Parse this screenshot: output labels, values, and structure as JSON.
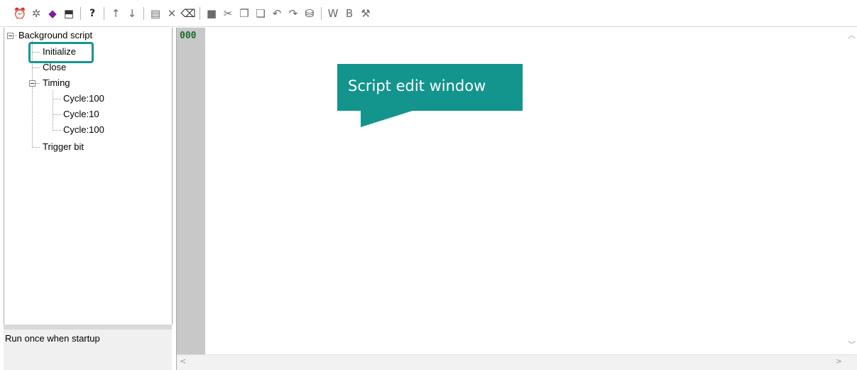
{
  "toolbar": {
    "buttons": [
      {
        "icon": "alarm-clock-icon",
        "glyph": "⏰"
      },
      {
        "icon": "tool-icon",
        "glyph": "✲"
      },
      {
        "icon": "gem-icon",
        "glyph": "◆"
      },
      {
        "icon": "disk-icon",
        "glyph": "⬒"
      },
      {
        "icon": "help-icon",
        "glyph": "?"
      },
      {
        "icon": "move-up-icon",
        "glyph": "↑"
      },
      {
        "icon": "move-down-icon",
        "glyph": "↓"
      },
      {
        "icon": "document-icon",
        "glyph": "▤"
      },
      {
        "icon": "delete-icon",
        "glyph": "✕"
      },
      {
        "icon": "eraser-icon",
        "glyph": "⌫"
      },
      {
        "icon": "save-icon",
        "glyph": "■"
      },
      {
        "icon": "cut-icon",
        "glyph": "✂"
      },
      {
        "icon": "copy-icon",
        "glyph": "❐"
      },
      {
        "icon": "paste-icon",
        "glyph": "❏"
      },
      {
        "icon": "undo-icon",
        "glyph": "↶"
      },
      {
        "icon": "redo-icon",
        "glyph": "↷"
      },
      {
        "icon": "database-icon",
        "glyph": "⛁"
      },
      {
        "icon": "word-button",
        "glyph": "W"
      },
      {
        "icon": "bit-button",
        "glyph": "B"
      },
      {
        "icon": "hammer-icon",
        "glyph": "⚒"
      }
    ]
  },
  "tree": {
    "root": "Background script",
    "initialize": "Initialize",
    "close": "Close",
    "timing": "Timing",
    "cycles": [
      "Cycle:100",
      "Cycle:10",
      "Cycle:100"
    ],
    "trigger": "Trigger bit"
  },
  "description": "Run once when startup",
  "editor": {
    "line_number": "000"
  },
  "callout": "Script edit window",
  "colors": {
    "accent": "#13948d",
    "gutter": "#c8c8c8",
    "line_number": "#1a6a2a"
  }
}
